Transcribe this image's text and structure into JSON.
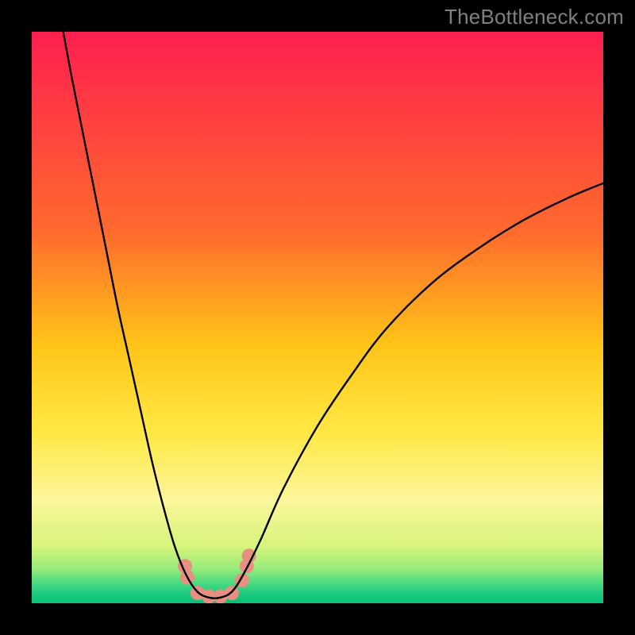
{
  "watermark": "TheBottleneck.com",
  "chart_data": {
    "type": "line",
    "title": "",
    "xlabel": "",
    "ylabel": "",
    "xlim": [
      0,
      100
    ],
    "ylim": [
      0,
      100
    ],
    "background_gradient": {
      "stops": [
        {
          "position": 0.0,
          "color": "#ff1f4f"
        },
        {
          "position": 0.35,
          "color": "#ff6a2d"
        },
        {
          "position": 0.55,
          "color": "#ffc518"
        },
        {
          "position": 0.7,
          "color": "#ffe843"
        },
        {
          "position": 0.82,
          "color": "#fbf69b"
        },
        {
          "position": 0.9,
          "color": "#d7f47c"
        },
        {
          "position": 0.94,
          "color": "#96eb7a"
        },
        {
          "position": 0.965,
          "color": "#4ad981"
        },
        {
          "position": 0.985,
          "color": "#19c97f"
        },
        {
          "position": 1.0,
          "color": "#0bbf77"
        }
      ]
    },
    "series": [
      {
        "name": "bottleneck-curve",
        "color": "#000000",
        "stroke_width": 2.4,
        "points": [
          {
            "x": 5.5,
            "y": 100.0
          },
          {
            "x": 7.0,
            "y": 92.0
          },
          {
            "x": 9.0,
            "y": 82.0
          },
          {
            "x": 11.0,
            "y": 72.0
          },
          {
            "x": 13.0,
            "y": 62.0
          },
          {
            "x": 15.0,
            "y": 52.0
          },
          {
            "x": 17.0,
            "y": 43.0
          },
          {
            "x": 19.0,
            "y": 34.0
          },
          {
            "x": 21.0,
            "y": 25.0
          },
          {
            "x": 23.0,
            "y": 17.0
          },
          {
            "x": 25.0,
            "y": 10.0
          },
          {
            "x": 27.0,
            "y": 5.0
          },
          {
            "x": 29.0,
            "y": 2.0
          },
          {
            "x": 31.0,
            "y": 1.0
          },
          {
            "x": 33.0,
            "y": 1.0
          },
          {
            "x": 35.0,
            "y": 2.0
          },
          {
            "x": 37.0,
            "y": 5.0
          },
          {
            "x": 40.0,
            "y": 11.0
          },
          {
            "x": 44.0,
            "y": 20.0
          },
          {
            "x": 50.0,
            "y": 31.0
          },
          {
            "x": 56.0,
            "y": 40.0
          },
          {
            "x": 62.0,
            "y": 48.0
          },
          {
            "x": 70.0,
            "y": 56.0
          },
          {
            "x": 78.0,
            "y": 62.0
          },
          {
            "x": 86.0,
            "y": 67.0
          },
          {
            "x": 94.0,
            "y": 71.0
          },
          {
            "x": 100.0,
            "y": 73.5
          }
        ]
      },
      {
        "name": "bottom-markers",
        "color": "#e78f81",
        "type": "scatter",
        "marker_radius_px": 9,
        "points": [
          {
            "x": 26.8,
            "y": 6.5
          },
          {
            "x": 27.2,
            "y": 4.5
          },
          {
            "x": 29.0,
            "y": 1.8
          },
          {
            "x": 31.0,
            "y": 1.2
          },
          {
            "x": 33.0,
            "y": 1.2
          },
          {
            "x": 35.0,
            "y": 1.8
          },
          {
            "x": 36.8,
            "y": 4.0
          },
          {
            "x": 37.6,
            "y": 6.5
          },
          {
            "x": 38.0,
            "y": 8.3
          }
        ]
      }
    ]
  }
}
